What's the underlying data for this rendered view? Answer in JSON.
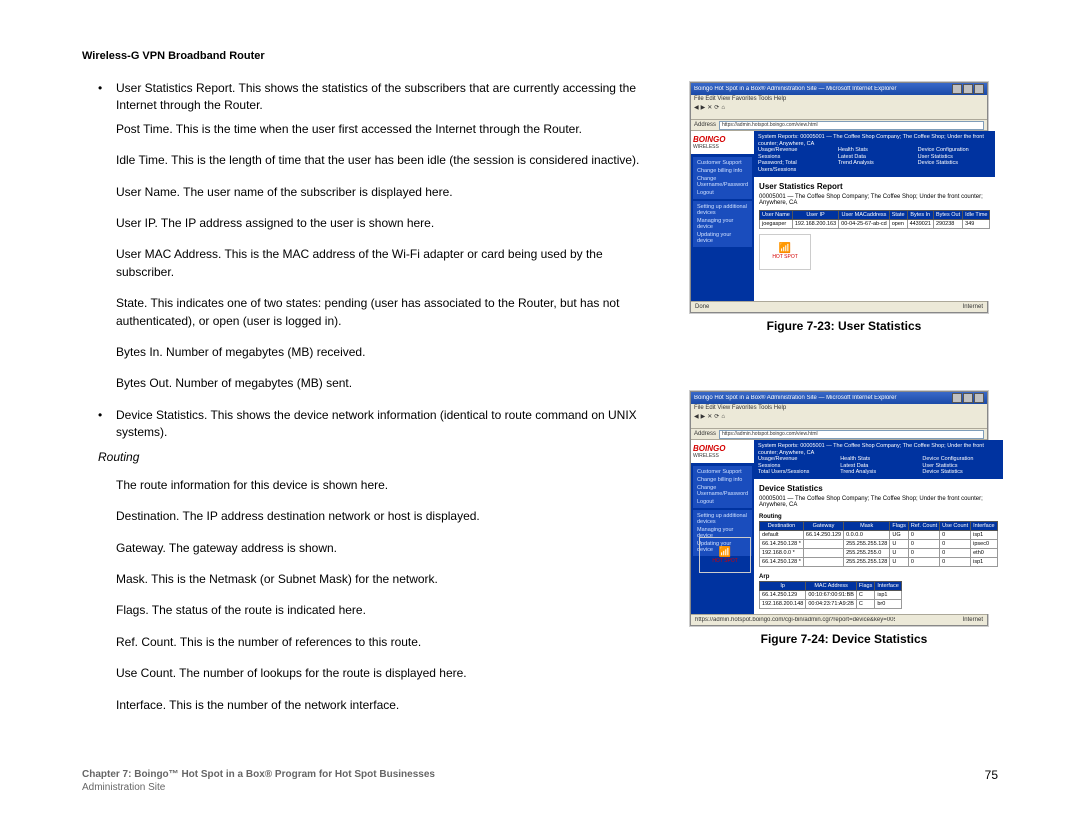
{
  "header": "Wireless-G VPN Broadband Router",
  "content": {
    "bullet1": "User Statistics Report. This shows the statistics of the subscribers that are currently accessing the Internet through the Router.",
    "s1": "Post Time. This is the time when the user first accessed the Internet through the Router.",
    "s2": "Idle Time. This is the length of time that the user has been idle (the session is considered inactive).",
    "s3": "User Name. The user name of the subscriber is displayed here.",
    "s4": "User IP. The IP address assigned to the user is shown here.",
    "s5": "User MAC Address. This is the MAC address of the Wi-Fi adapter or card being used by the subscriber.",
    "s6": "State. This indicates one of two states: pending (user has associated to the Router, but has not authenticated), or open (user is logged in).",
    "s7": "Bytes In. Number of megabytes (MB) received.",
    "s8": "Bytes Out. Number of megabytes (MB) sent.",
    "bullet2": "Device Statistics. This shows the device network information (identical to route command on UNIX systems).",
    "heading": "Routing",
    "r1": "The route information for this device is shown here.",
    "r2": "Destination. The IP address destination network or host is displayed.",
    "r3": "Gateway. The gateway address is shown.",
    "r4": "Mask. This is the Netmask (or Subnet Mask) for the network.",
    "r5": "Flags. The status of the route is indicated here.",
    "r6": "Ref. Count. This is the number of references to this route.",
    "r7": "Use Count. The number of lookups for the route is displayed here.",
    "r8": "Interface. This is the number of the network interface."
  },
  "fig1": {
    "caption": "Figure 7-23: User Statistics",
    "window_title": "Boingo Hot Spot in a Box® Administration Site — Microsoft Internet Explorer",
    "menu": "File   Edit   View   Favorites   Tools   Help",
    "addr_label": "Address",
    "addr_val": "https://admin.hotspot.boingo.com/view.html",
    "brand": "BOINGO",
    "brand_sub": "WIRELESS",
    "report_title": "User Statistics Report",
    "report_sub": "00005001 — The Coffee Shop Company; The Coffee Shop; Under the front counter; Anywhere, CA",
    "cols": [
      "User Name",
      "User IP",
      "User MACaddress",
      "State",
      "Bytes In",
      "Bytes Out",
      "Idle Time"
    ],
    "row": [
      "joegasper",
      "192.168.200.163",
      "00-04-25-67-ab-cd",
      "open",
      "4439021",
      "290238",
      "349"
    ],
    "hotspot": "HOT SPOT",
    "status_left": "Done",
    "status_right": "Internet"
  },
  "fig2": {
    "caption": "Figure 7-24: Device Statistics",
    "window_title": "Boingo Hot Spot in a Box® Administration Site — Microsoft Internet Explorer",
    "menu": "File   Edit   View   Favorites   Tools   Help",
    "addr_label": "Address",
    "addr_val": "https://admin.hotspot.boingo.com/view.html",
    "brand": "BOINGO",
    "brand_sub": "WIRELESS",
    "report_title": "Device Statistics",
    "report_sub": "00005001 — The Coffee Shop Company; The Coffee Shop; Under the front counter; Anywhere, CA",
    "sec_routing": "Routing",
    "routing_cols": [
      "Destination",
      "Gateway",
      "Mask",
      "Flags",
      "Ref. Count",
      "Use Count",
      "Interface"
    ],
    "routing_rows": [
      [
        "default",
        "66.14.250.129",
        "0.0.0.0",
        "UG",
        "0",
        "0",
        "isp1"
      ],
      [
        "66.14.250.128 *",
        "",
        "255.255.255.128",
        "U",
        "0",
        "0",
        "ipsec0"
      ],
      [
        "192.168.0.0 *",
        "",
        "255.255.255.0",
        "U",
        "0",
        "0",
        "eth0"
      ],
      [
        "66.14.250.128 *",
        "",
        "255.255.255.128",
        "U",
        "0",
        "0",
        "isp1"
      ]
    ],
    "sec_arp": "Arp",
    "arp_cols": [
      "Ip",
      "MAC Address",
      "Flags",
      "Interface"
    ],
    "arp_rows": [
      [
        "66.14.250.129",
        "00:10:67:00:91:BB",
        "C",
        "isp1"
      ],
      [
        "192.168.200.148",
        "00:04:23:71:A9:2B",
        "C",
        "br0"
      ]
    ],
    "status_left": "https://admin.hotspot.boingo.com/cgi-bin/admin.cgi?report=device&key=0057…",
    "status_right": "Internet"
  },
  "footer": {
    "chapter": "Chapter 7: Boingo™ Hot Spot in a Box® Program for Hot Spot Businesses",
    "sub": "Administration Site",
    "page": "75"
  }
}
